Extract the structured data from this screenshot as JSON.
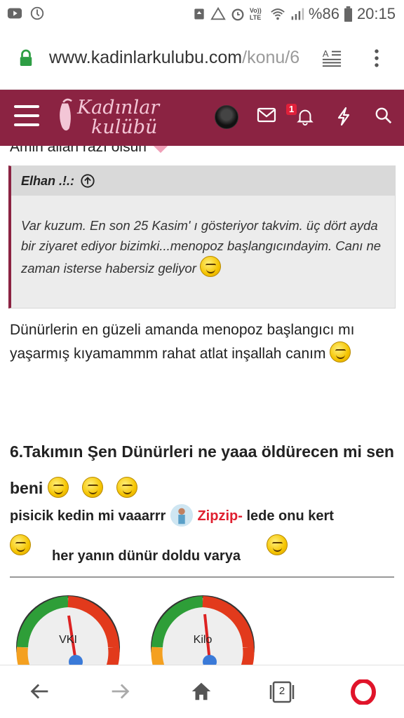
{
  "status_bar": {
    "battery_text": "%86",
    "time": "20:15",
    "network_label": "Vo)) LTE"
  },
  "browser": {
    "url_main": "www.kadinlarkulubu.com",
    "url_rest": "/konu/6"
  },
  "site": {
    "logo_line1": "Kadınlar",
    "logo_line2": "kulübü",
    "notification_count": "1"
  },
  "post": {
    "cut_text": "Amin allah razı olsun",
    "quote_author": "Elhan .!.:",
    "quote_text": "Var kuzum. En son 25 Kasim' ı gösteriyor takvim. üç dört ayda bir ziyaret ediyor bizimki...menopoz başlangıcındayim. Canı ne zaman isterse habersiz geliyor",
    "reply_text": "Dünürlerin en güzeli amanda menopoz başlangıcı mı yaşarmış kıyamammm rahat atlat inşallah canım",
    "heading": "6.Takımın Şen Dünürleri ne yaaa öldürecen mi sen beni",
    "line2_a": "pisicik kedin mi vaaarrr",
    "mention": "Zipzip-",
    "line2_b": "lede onu kert",
    "line3": "her yanın dünür doldu varya"
  },
  "gauges": [
    {
      "label": "VKI"
    },
    {
      "label": "Kilo"
    }
  ],
  "nav": {
    "tab_count": "2"
  },
  "colors": {
    "brand": "#8b2342",
    "mention": "#e02030",
    "opera": "#e0142a"
  }
}
